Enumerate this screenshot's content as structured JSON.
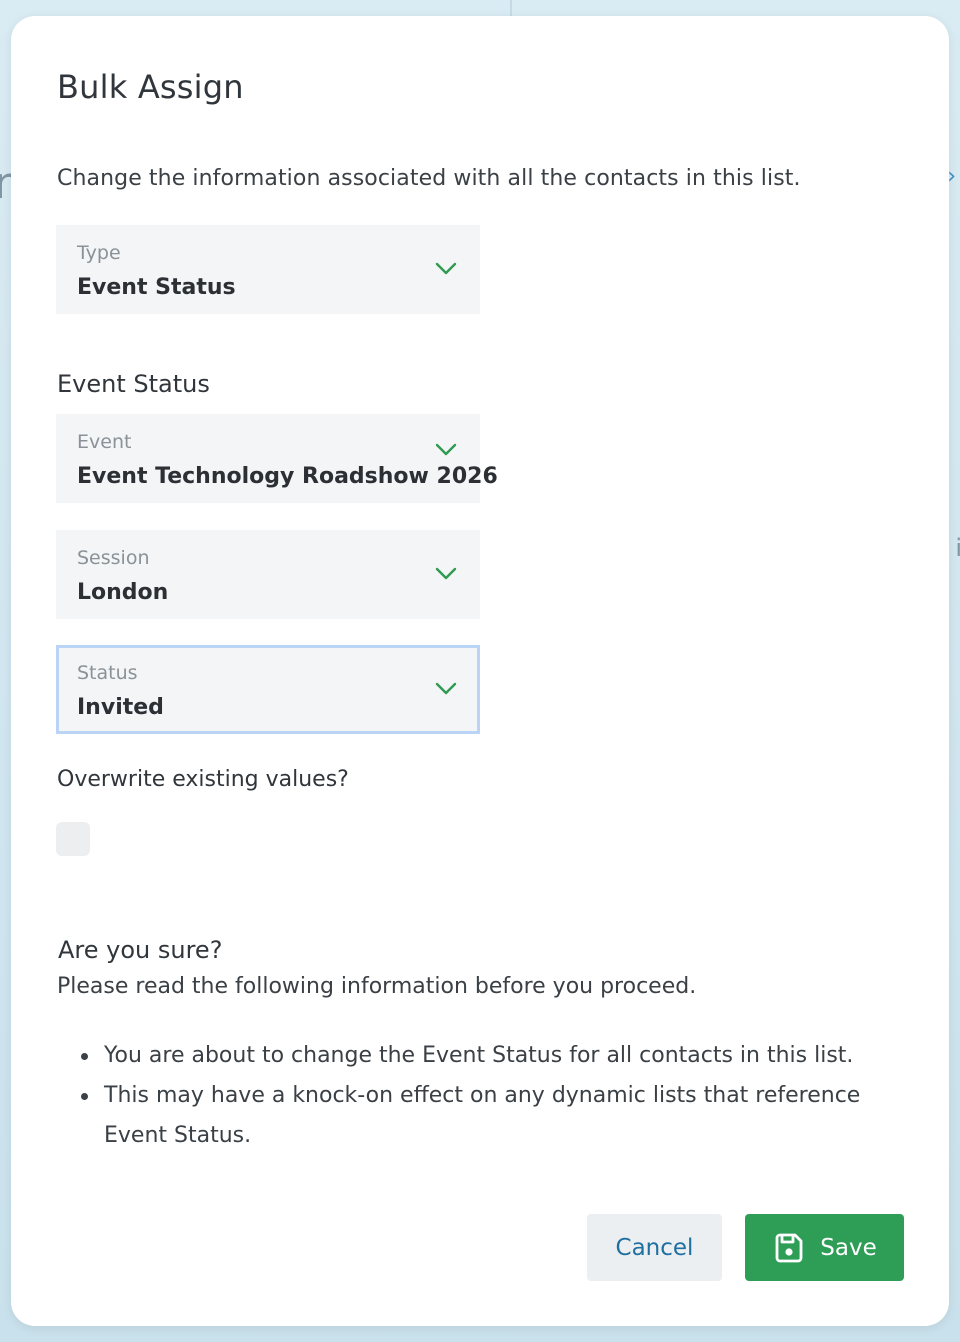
{
  "dialog": {
    "title": "Bulk Assign",
    "intro": "Change the information associated with all the contacts in this list."
  },
  "fields": {
    "type": {
      "label": "Type",
      "value": "Event Status"
    },
    "section_label": "Event Status",
    "event": {
      "label": "Event",
      "value": "Event Technology Roadshow 2026"
    },
    "session": {
      "label": "Session",
      "value": "London"
    },
    "status": {
      "label": "Status",
      "value": "Invited"
    }
  },
  "overwrite": {
    "label": "Overwrite existing values?",
    "checked": false
  },
  "confirm": {
    "title": "Are you sure?",
    "subtitle": "Please read the following information before you proceed.",
    "bullets": [
      "You are about to change the Event Status for all contacts in this list.",
      "This may have a knock-on effect on any dynamic lists that reference Event Status."
    ]
  },
  "buttons": {
    "cancel": "Cancel",
    "save": "Save"
  },
  "icons": {
    "chevron": "chevron-down-icon",
    "save": "floppy-disk-icon"
  },
  "colors": {
    "accent_green": "#2e9e57",
    "chevron_green": "#2f9a50",
    "link_blue": "#1f6fa0",
    "focus_ring": "#b9d4f5"
  }
}
